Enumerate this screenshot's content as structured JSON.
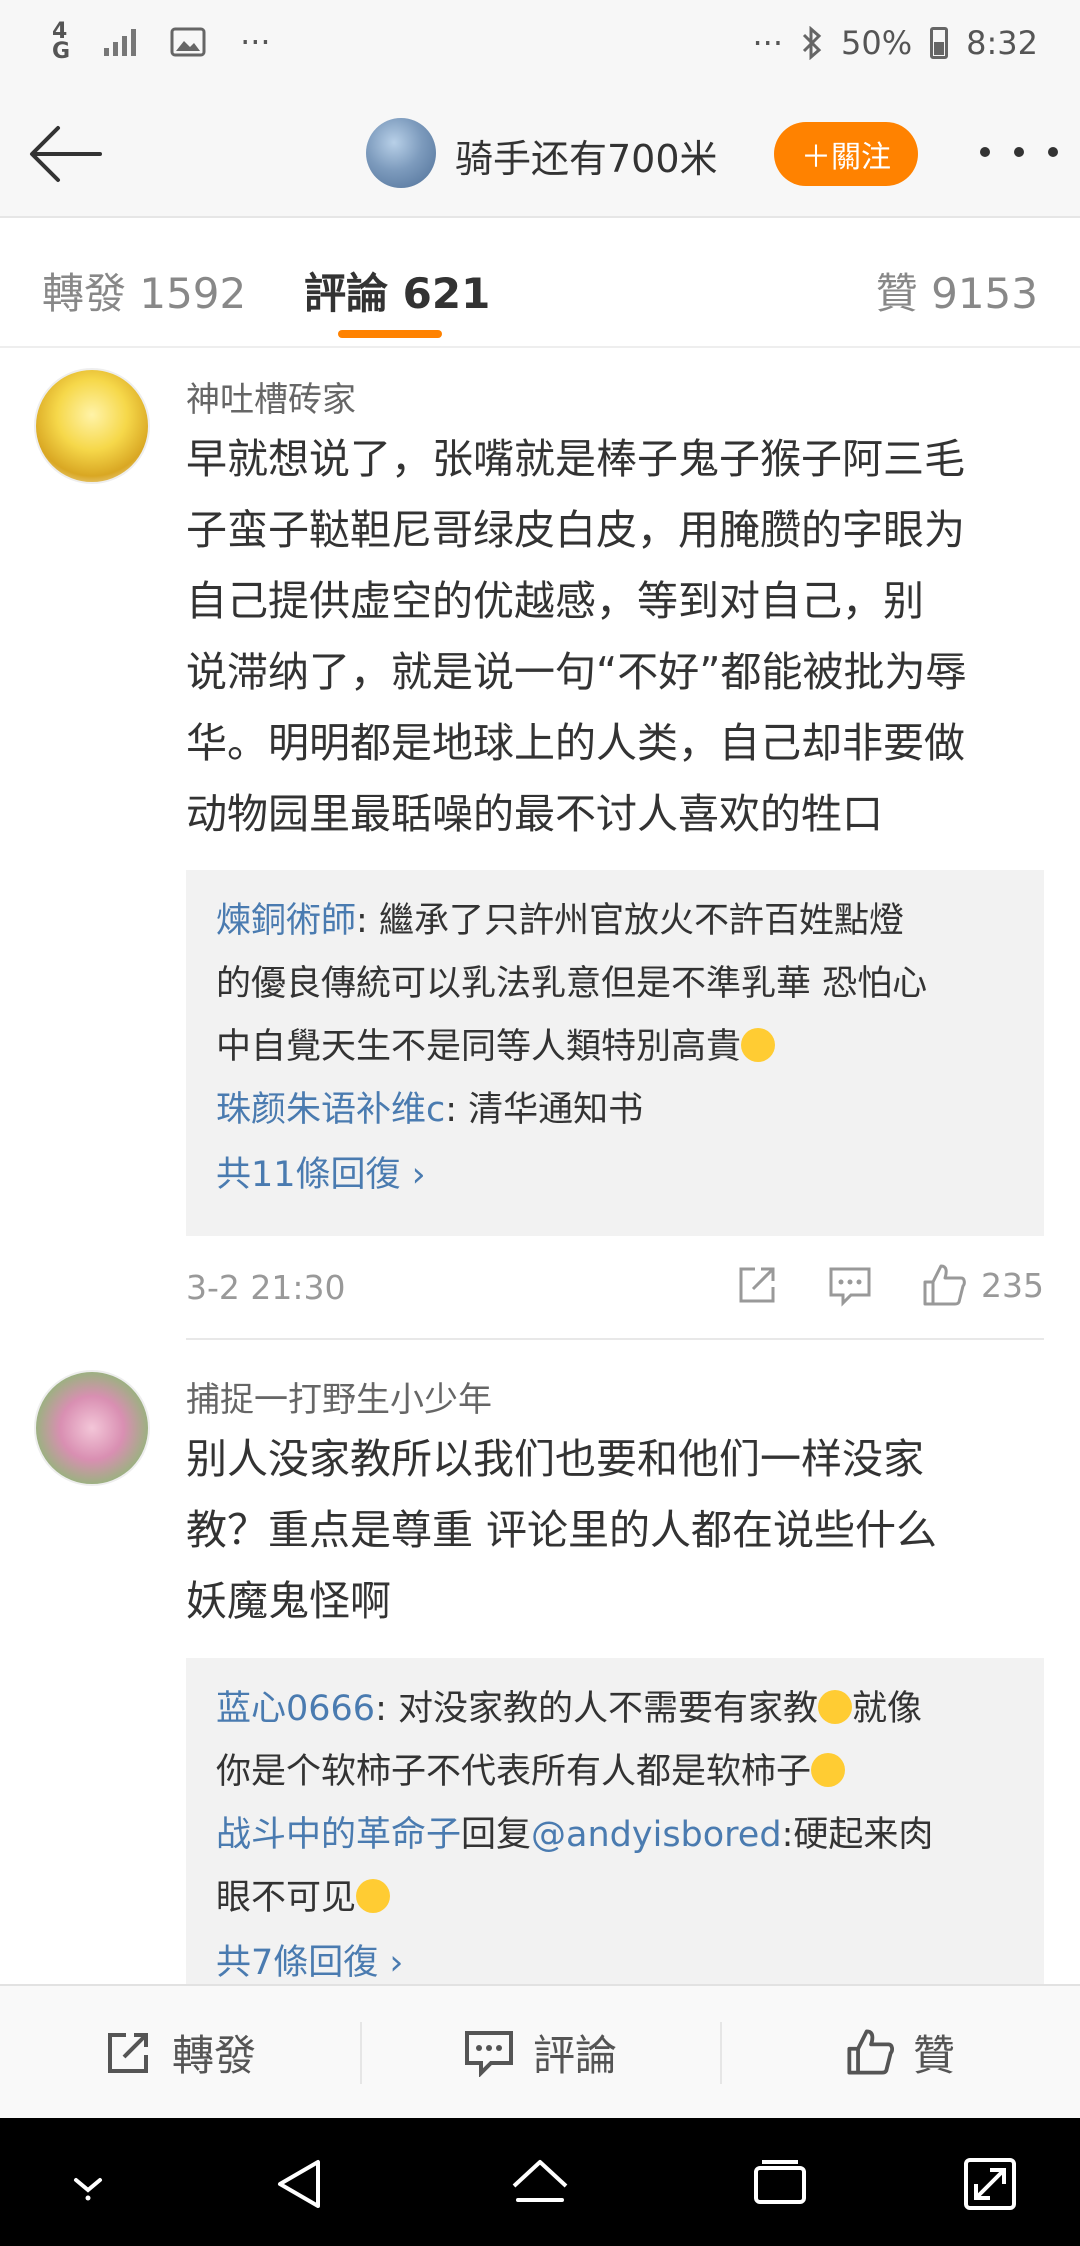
{
  "status_bar": {
    "network": "4G",
    "battery": "50%",
    "time": "8:32",
    "dots_left": "···",
    "dots_right": "···"
  },
  "header": {
    "title": "骑手还有700米",
    "follow_label": "＋關注"
  },
  "tabs": {
    "repost": "轉發 1592",
    "comment": "評論 621",
    "like": "贊 9153"
  },
  "comments": [
    {
      "user": "神吐槽砖家",
      "lines": [
        "早就想说了，张嘴就是棒子鬼子猴子阿三毛",
        "子蛮子鞑靼尼哥绿皮白皮，用腌臜的字眼为",
        "自己提供虚空的优越感，等到对自己，别",
        "说滞纳了，就是说一句“不好”都能被批为辱",
        "华。明明都是地球上的人类，自己却非要做",
        "动物园里最聒噪的最不讨人喜欢的牲口"
      ],
      "replies": [
        {
          "user": "煉銅術師",
          "sep": ": ",
          "text1": "繼承了只許州官放火不許百姓點燈",
          "text2": "的優良傳統可以乳法乳意但是不準乳華 恐怕心",
          "text3": "中自覺天生不是同等人類特別高貴"
        },
        {
          "user": "珠颜朱语补维c",
          "sep": ": ",
          "text1": "清华通知书"
        }
      ],
      "more_replies": "共11條回復 ›",
      "time": "3-2 21:30",
      "likes": "235"
    },
    {
      "user": "捕捉一打野生小少年",
      "lines": [
        "别人没家教所以我们也要和他们一样没家",
        "教？重点是尊重 评论里的人都在说些什么",
        "妖魔鬼怪啊"
      ],
      "replies": [
        {
          "user": "蓝心0666",
          "sep": ": ",
          "text1": "对没家教的人不需要有家教",
          "text1b": "就像",
          "text2": "你是个软柿子不代表所有人都是软柿子"
        },
        {
          "user": "战斗中的革命子",
          "mid": "回复",
          "mention": "@andyisbored",
          "text1": ":硬起来肉",
          "text2": "眼不可见"
        }
      ],
      "more_replies": "共7條回復 ›"
    }
  ],
  "toolbar": {
    "repost": "轉發",
    "comment": "評論",
    "like": "贊"
  },
  "colors": {
    "accent": "#ff8200",
    "link": "#4a7bb0"
  }
}
